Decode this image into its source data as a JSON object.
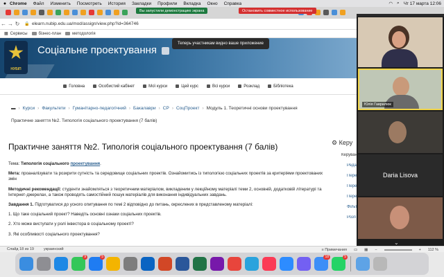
{
  "menubar": {
    "app": "Chrome",
    "items": [
      "Файл",
      "Изменить",
      "Посмотреть",
      "История",
      "Закладки",
      "Профили",
      "Вкладка",
      "Окно",
      "Справка"
    ],
    "clock": "Чт 17 марта 12:06"
  },
  "sharing": {
    "banner": "Вы запустили демонстрацию экрана",
    "stop": "Остановить совместное использование",
    "tooltip": "Теперь участникам видно ваше приложение"
  },
  "address": {
    "url": "elearn.nubip.edu.ua/mod/assign/view.php?id=364746"
  },
  "bookmarks": [
    {
      "label": "Сервисы"
    },
    {
      "label": "бізнес-план"
    },
    {
      "label": "методологія"
    }
  ],
  "site": {
    "title": "Соціальне проектування",
    "logo_text": "НУБІП"
  },
  "nav": [
    "Головна",
    "Особистий кабінет",
    "Мої курси",
    "Цей курс",
    "Всі курси",
    "Розклад",
    "Бібліотека"
  ],
  "breadcrumb": [
    "Курси",
    "Факультети",
    "Гуманітарно-педагогічний",
    "Бакалаври",
    "СР",
    "СоцПроект",
    "Модуль 1. Теоретичні основи проектування"
  ],
  "breadcrumb2": "Практичне заняття №2. Типологія соціального проектування (7 балів)",
  "page": {
    "title": "Практичне заняття №2. Типологія соціального проектування (7 балів)",
    "topic_label": "Тема:",
    "topic_value": "Типологія соціального",
    "topic_link": "проектування",
    "goal_label": "Мета:",
    "goal_text": "проаналізувати та розкрити сутність та середовище соціальних проектів. Ознайомитись із типологією соціальних проектів за критеріями проектованих змін",
    "method_label": "Методичні рекомендації:",
    "method_text": "студенти знайомляться з теоретичним матеріалом, викладеним у лекційному матеріалі теми 2, основній, додатковій літературі та Інтернет-джерелах, а також проводять самостійний пошук матеріалів для виконання індивідуальних завдань.",
    "task_label": "Завдання 1.",
    "task_text": "Підготуватися до усного опитування по темі 2 відповідно до питань, окреслених в представленому матеріалі:",
    "q1": "1.   Що таке соціальний проект? Наведіть основні ознаки соціальних проектів.",
    "q2": "2.   Хто може виступати у ролі інвестора в соціальному проекті?",
    "q3": "3.   Які особливості соціального проектування?"
  },
  "sidebar": {
    "header": "Керу",
    "items": [
      "Керування",
      "Реда",
      "Пере",
      "Пере",
      "Пере",
      "Фільт",
      "Розп"
    ]
  },
  "video": {
    "participants": [
      "",
      "Юлія Гаврилюк",
      "",
      "Daria Lisova",
      ""
    ]
  },
  "statusbar": {
    "slide": "Слайд 18 из 19",
    "lang": "украинский",
    "notes": "Примечания",
    "zoom": "112 %"
  },
  "dock": [
    {
      "name": "finder",
      "color": "#3a8de0"
    },
    {
      "name": "launchpad",
      "color": "#8e8e93"
    },
    {
      "name": "safari",
      "color": "#1e88e5"
    },
    {
      "name": "messages",
      "color": "#34c759",
      "badge": "9"
    },
    {
      "name": "appstore",
      "color": "#1f7cf2",
      "badge": "5"
    },
    {
      "name": "photos",
      "color": "#f4b400"
    },
    {
      "name": "settings",
      "color": "#7d7d7d"
    },
    {
      "name": "outlook",
      "color": "#0a64c2"
    },
    {
      "name": "powerpoint",
      "color": "#d24726"
    },
    {
      "name": "word",
      "color": "#2b579a"
    },
    {
      "name": "excel",
      "color": "#217346"
    },
    {
      "name": "onenote",
      "color": "#7719aa"
    },
    {
      "name": "chrome",
      "color": "#e8453c"
    },
    {
      "name": "telegram",
      "color": "#2aa3dd"
    },
    {
      "name": "music",
      "color": "#fb3a55"
    },
    {
      "name": "zoom",
      "color": "#2d8cff"
    },
    {
      "name": "viber",
      "color": "#7360f2"
    },
    {
      "name": "mail",
      "color": "#3d8ef7",
      "badge": "18"
    },
    {
      "name": "whatsapp",
      "color": "#25d366",
      "badge": "5"
    },
    {
      "name": "downloads",
      "color": "#5ea3e6"
    },
    {
      "name": "trash",
      "color": "#b8b8b8"
    }
  ]
}
